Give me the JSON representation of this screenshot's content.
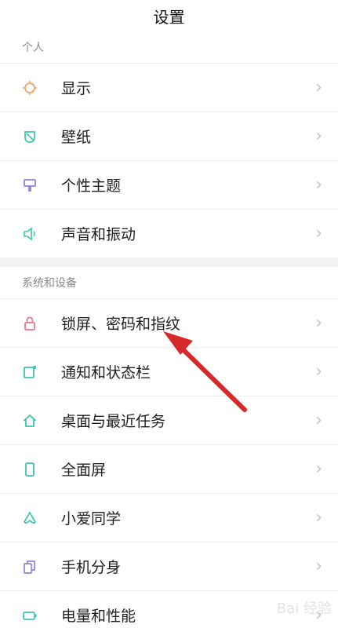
{
  "header": {
    "title": "设置"
  },
  "sections": [
    {
      "title": "个人",
      "items": [
        {
          "label": "显示",
          "icon": "brightness-icon",
          "color": "#f2a36b"
        },
        {
          "label": "壁纸",
          "icon": "wallpaper-icon",
          "color": "#3cc6b0"
        },
        {
          "label": "个性主题",
          "icon": "theme-brush-icon",
          "color": "#8f83d8"
        },
        {
          "label": "声音和振动",
          "icon": "speaker-icon",
          "color": "#3cc6b0"
        }
      ]
    },
    {
      "title": "系统和设备",
      "items": [
        {
          "label": "锁屏、密码和指纹",
          "icon": "lock-icon",
          "color": "#e07a86"
        },
        {
          "label": "通知和状态栏",
          "icon": "notification-icon",
          "color": "#3cc6b0"
        },
        {
          "label": "桌面与最近任务",
          "icon": "home-icon",
          "color": "#3cc6b0"
        },
        {
          "label": "全面屏",
          "icon": "fullscreen-phone-icon",
          "color": "#3cc6b0"
        },
        {
          "label": "小爱同学",
          "icon": "xiaoai-icon",
          "color": "#3cc6b0"
        },
        {
          "label": "手机分身",
          "icon": "dual-phone-icon",
          "color": "#8f83d8"
        },
        {
          "label": "电量和性能",
          "icon": "battery-icon",
          "color": "#3cc6b0"
        }
      ]
    }
  ],
  "watermark": "Bai 经验",
  "annotation_color": "#d62a2a"
}
